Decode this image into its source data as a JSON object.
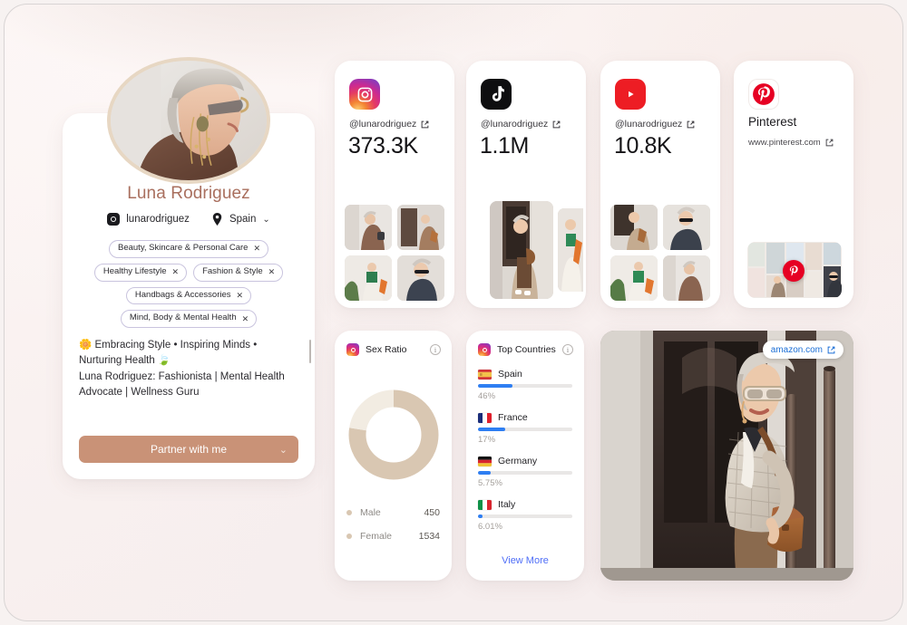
{
  "profile": {
    "name": "Luna Rodriguez",
    "handle": "lunarodriguez",
    "country": "Spain",
    "chevron": "⌄",
    "tags": [
      "Beauty, Skincare & Personal Care",
      "Healthy Lifestyle",
      "Fashion & Style",
      "Handbags & Accessories",
      "Mind, Body & Mental Health"
    ],
    "tag_remove": "✕",
    "bio_line1": "🌼 Embracing Style • Inspiring Minds • Nurturing Health 🍃",
    "bio_line2": "Luna Rodriguez: Fashionista | Mental Health Advocate | Wellness Guru",
    "partner_label": "Partner with me",
    "partner_chevron": "⌄"
  },
  "socials": [
    {
      "platform": "instagram",
      "icon": "instagram-icon",
      "handle": "@lunarodriguez",
      "count": "373.3K"
    },
    {
      "platform": "tiktok",
      "icon": "tiktok-icon",
      "handle": "@lunarodriguez",
      "count": "1.1M"
    },
    {
      "platform": "youtube",
      "icon": "youtube-icon",
      "handle": "@lunarodriguez",
      "count": "10.8K"
    },
    {
      "platform": "pinterest",
      "icon": "pinterest-icon",
      "title": "Pinterest",
      "url": "www.pinterest.com"
    }
  ],
  "sex_ratio": {
    "title": "Sex Ratio",
    "source_icon": "instagram-icon",
    "info_icon": "info-icon",
    "male_label": "Male",
    "male_value": "450",
    "female_label": "Female",
    "female_value": "1534",
    "male_color": "#f2ece2",
    "female_color": "#d9c7b2"
  },
  "top_countries": {
    "title": "Top Countries",
    "source_icon": "instagram-icon",
    "info_icon": "info-icon",
    "view_more": "View More",
    "bar_color": "#2e7ef2",
    "rows": [
      {
        "flag": "spain-flag",
        "name": "Spain",
        "pct": "46%",
        "bar": 37
      },
      {
        "flag": "france-flag",
        "name": "France",
        "pct": "17%",
        "bar": 29
      },
      {
        "flag": "germany-flag",
        "name": "Germany",
        "pct": "5.75%",
        "bar": 13
      },
      {
        "flag": "italy-flag",
        "name": "Italy",
        "pct": "6.01%",
        "bar": 5
      }
    ]
  },
  "hero": {
    "badge_label": "amazon.com",
    "badge_icon": "external-link-icon"
  },
  "chart_data": {
    "type": "pie",
    "title": "Sex Ratio",
    "labels": [
      "Male",
      "Female"
    ],
    "values": [
      450,
      1534
    ],
    "colors": [
      "#f2ece2",
      "#d9c7b2"
    ],
    "legend": "bottom",
    "donut": true
  }
}
